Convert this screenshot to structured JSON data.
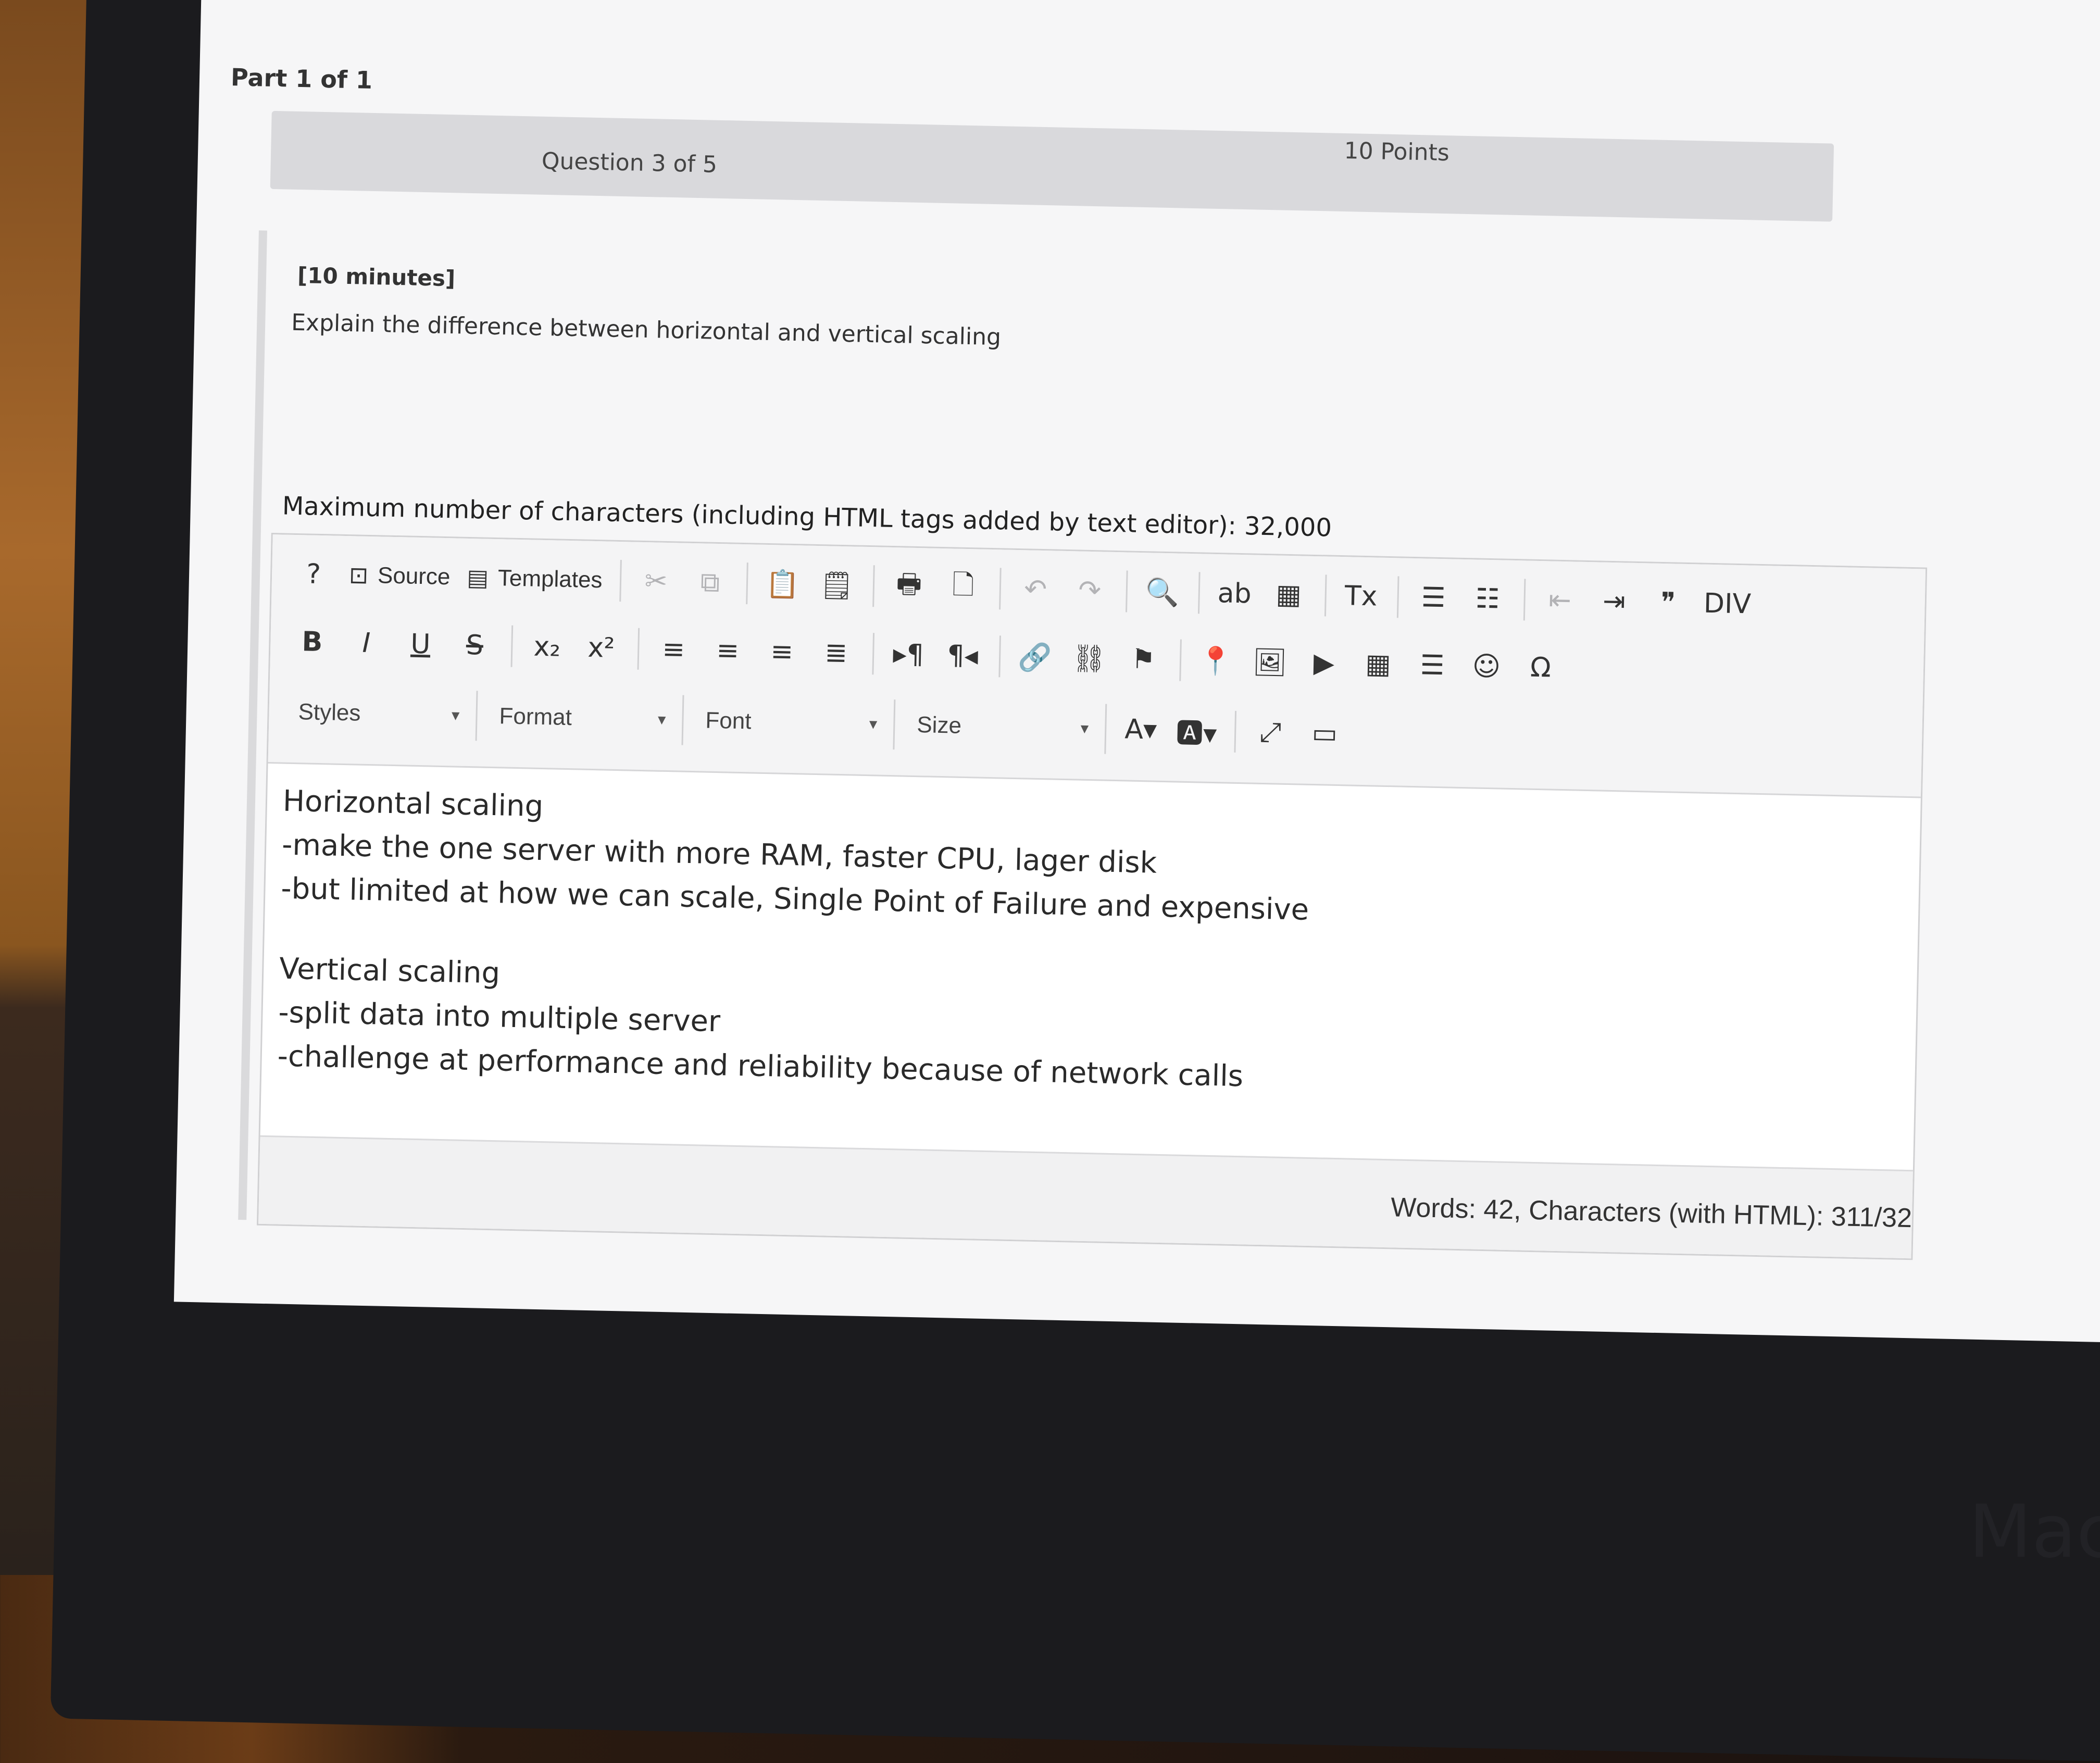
{
  "part_label": "Part 1 of 1",
  "question": {
    "count": "Question 3 of 5",
    "points": "10 Points",
    "time": "[10 minutes]",
    "text": "Explain the difference between horizontal and vertical scaling"
  },
  "max_chars": "Maximum number of characters (including HTML tags added by text editor): 32,000",
  "toolbar": {
    "row1": [
      {
        "name": "help",
        "glyph": "?",
        "kind": "icon"
      },
      {
        "name": "source",
        "glyph": "⊡",
        "label": "Source",
        "kind": "text"
      },
      {
        "name": "templates",
        "glyph": "▤",
        "label": "Templates",
        "kind": "text"
      },
      {
        "name": "cut",
        "glyph": "✂",
        "kind": "faded"
      },
      {
        "name": "copy",
        "glyph": "⧉",
        "kind": "faded"
      },
      {
        "name": "paste",
        "glyph": "📋",
        "kind": "icon"
      },
      {
        "name": "paste-text",
        "glyph": "🗒",
        "kind": "icon"
      },
      {
        "name": "print",
        "glyph": "🖶",
        "kind": "icon"
      },
      {
        "name": "preview",
        "glyph": "🗋",
        "kind": "icon"
      },
      {
        "name": "undo",
        "glyph": "↶",
        "kind": "faded"
      },
      {
        "name": "redo",
        "glyph": "↷",
        "kind": "faded"
      },
      {
        "name": "find",
        "glyph": "🔍",
        "kind": "icon"
      },
      {
        "name": "replace",
        "glyph": "ab",
        "kind": "icon"
      },
      {
        "name": "select-all",
        "glyph": "▦",
        "kind": "icon"
      },
      {
        "name": "remove-format",
        "glyph": "Tx",
        "kind": "icon"
      },
      {
        "name": "numbered-list",
        "glyph": "☰",
        "kind": "icon"
      },
      {
        "name": "bulleted-list",
        "glyph": "☷",
        "kind": "icon"
      },
      {
        "name": "outdent",
        "glyph": "⇤",
        "kind": "faded"
      },
      {
        "name": "indent",
        "glyph": "⇥",
        "kind": "icon"
      },
      {
        "name": "blockquote",
        "glyph": "❞",
        "kind": "icon"
      },
      {
        "name": "div",
        "glyph": "DIV",
        "kind": "icon"
      }
    ],
    "row2": [
      {
        "name": "bold",
        "glyph": "B"
      },
      {
        "name": "italic",
        "glyph": "I"
      },
      {
        "name": "underline",
        "glyph": "U"
      },
      {
        "name": "strike",
        "glyph": "S"
      },
      {
        "name": "subscript",
        "glyph": "x₂"
      },
      {
        "name": "superscript",
        "glyph": "x²"
      },
      {
        "name": "align-left",
        "glyph": "≡"
      },
      {
        "name": "align-center",
        "glyph": "≡"
      },
      {
        "name": "align-right",
        "glyph": "≡"
      },
      {
        "name": "justify",
        "glyph": "≣"
      },
      {
        "name": "ltr",
        "glyph": "▸¶"
      },
      {
        "name": "rtl",
        "glyph": "¶◂"
      },
      {
        "name": "link",
        "glyph": "🔗"
      },
      {
        "name": "unlink",
        "glyph": "⛓"
      },
      {
        "name": "anchor",
        "glyph": "⚑"
      },
      {
        "name": "pin",
        "glyph": "📍"
      },
      {
        "name": "image",
        "glyph": "🖼"
      },
      {
        "name": "video",
        "glyph": "▶"
      },
      {
        "name": "table",
        "glyph": "▦"
      },
      {
        "name": "horizontal-rule",
        "glyph": "☰"
      },
      {
        "name": "smiley",
        "glyph": "☺"
      },
      {
        "name": "special-char",
        "glyph": "Ω"
      }
    ],
    "row3": {
      "styles": "Styles",
      "format": "Format",
      "font": "Font",
      "size": "Size",
      "icons": [
        {
          "name": "text-color",
          "glyph": "A▾"
        },
        {
          "name": "background-color",
          "glyph": "🅰▾"
        },
        {
          "name": "maximize",
          "glyph": "⤢"
        },
        {
          "name": "show-blocks",
          "glyph": "▭"
        }
      ]
    }
  },
  "content": {
    "lines": [
      "Horizontal scaling",
      "-make the one server with more RAM, faster CPU, lager disk",
      "-but limited at how we can scale, Single Point of Failure and expensive",
      "",
      "Vertical scaling",
      "-split data into multiple server",
      "-challenge at performance and reliability because of network calls"
    ]
  },
  "status": "Words: 42, Characters (with HTML): 311/32",
  "mac_label": "Mac"
}
